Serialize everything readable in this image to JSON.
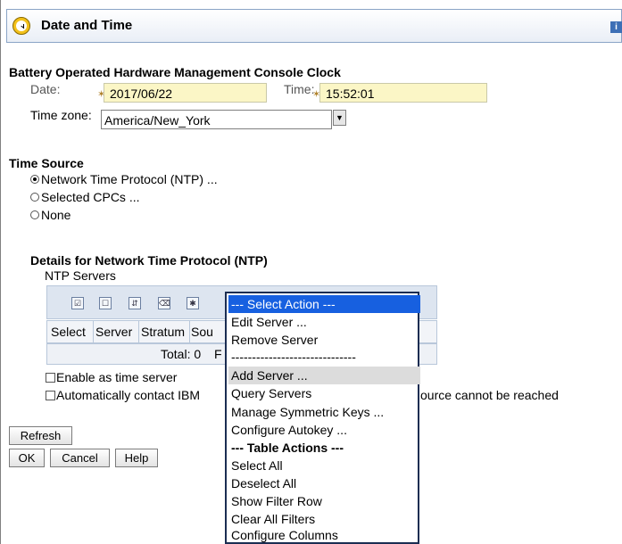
{
  "header": {
    "title": "Date and Time",
    "icon": "clock-icon",
    "info_glyph": "i"
  },
  "clock_section": {
    "title": "Battery Operated Hardware Management Console Clock",
    "date_label": "Date:",
    "date_value": "2017/06/22",
    "time_label": "Time:",
    "time_value": "15:52:01",
    "required_marker": "✶",
    "timezone_label": "Time zone:",
    "timezone_value": "America/New_York"
  },
  "time_source": {
    "title": "Time Source",
    "options": [
      {
        "label": "Network Time Protocol (NTP) ...",
        "selected": true
      },
      {
        "label": "Selected CPCs ...",
        "selected": false
      },
      {
        "label": "None",
        "selected": false
      }
    ]
  },
  "ntp_details": {
    "title": "Details for Network Time Protocol (NTP)",
    "servers_label": "NTP Servers",
    "columns": [
      "Select",
      "Server",
      "Stratum",
      "Sou"
    ],
    "total_label": "Total: 0",
    "total_trailing": "F",
    "enable_time_server": "Enable as time server",
    "auto_contact_prefix": "Automatically contact IBM",
    "auto_contact_suffix": "ource cannot be reached"
  },
  "action_menu": {
    "selected": "--- Select Action ---",
    "items": [
      "Edit Server ...",
      "Remove Server",
      "------------------------------",
      "Add Server ...",
      "Query Servers",
      "Manage Symmetric Keys ...",
      "Configure Autokey ...",
      "--- Table Actions ---",
      "Select All",
      "Deselect All",
      "Show Filter Row",
      "Clear All Filters",
      "Configure Columns"
    ]
  },
  "buttons": {
    "refresh": "Refresh",
    "ok": "OK",
    "cancel": "Cancel",
    "help": "Help"
  },
  "colors": {
    "highlight": "#1760e0",
    "required_field": "#fbf6c6",
    "hover": "#dcdcdc"
  }
}
